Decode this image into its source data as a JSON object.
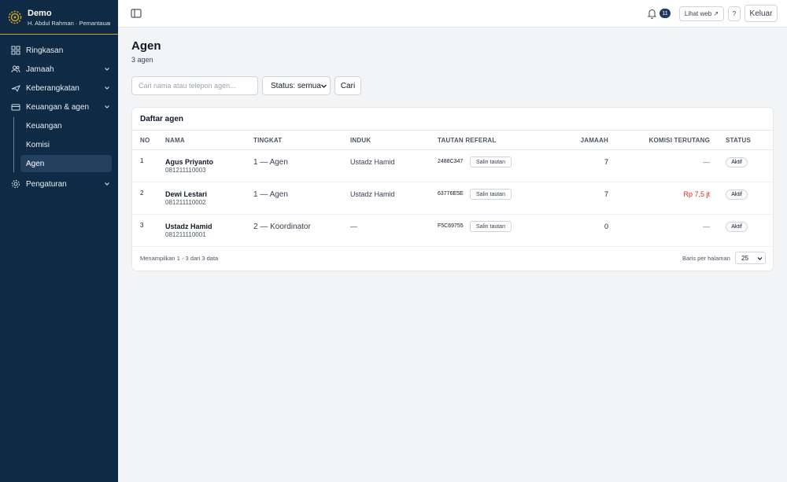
{
  "brand": {
    "title": "Demo",
    "subtitle": "H. Abdul Rahman · Pemantauan"
  },
  "sidebar": {
    "items": [
      {
        "label": "Ringkasan",
        "icon": "grid-icon"
      },
      {
        "label": "Jamaah",
        "icon": "users-icon"
      },
      {
        "label": "Keberangkatan",
        "icon": "plane-icon"
      },
      {
        "label": "Keuangan & agen",
        "icon": "wallet-icon"
      },
      {
        "label": "Pengaturan",
        "icon": "gear-icon"
      }
    ],
    "subitems": [
      {
        "label": "Keuangan"
      },
      {
        "label": "Komisi"
      },
      {
        "label": "Agen",
        "active": true
      }
    ]
  },
  "topbar": {
    "notif_count": "11",
    "lihat_web": "Lihat web ↗",
    "help": "?",
    "logout": "Keluar"
  },
  "page": {
    "title": "Agen",
    "subtitle": "3 agen"
  },
  "filters": {
    "search_placeholder": "Cari nama atau telepon agen...",
    "status": "Status: semua",
    "search_button": "Cari"
  },
  "table": {
    "title": "Daftar agen",
    "headers": {
      "no": "No",
      "name": "Nama",
      "tier": "Tingkat",
      "parent": "Induk",
      "ref": "Tautan referal",
      "jamaah": "Jamaah",
      "commission": "Komisi terutang",
      "status": "Status"
    },
    "copy_label": "Salin tautan",
    "rows": [
      {
        "no": "1",
        "name": "Agus Priyanto",
        "phone": "081211110003",
        "tier": "1 — Agen",
        "parent": "Ustadz Hamid",
        "ref": "2488C347",
        "jamaah": "7",
        "commission": "—",
        "status": "Aktif"
      },
      {
        "no": "2",
        "name": "Dewi Lestari",
        "phone": "081211110002",
        "tier": "1 — Agen",
        "parent": "Ustadz Hamid",
        "ref": "63776E5E",
        "jamaah": "7",
        "commission": "Rp 7,5 jt",
        "status": "Aktif"
      },
      {
        "no": "3",
        "name": "Ustadz Hamid",
        "phone": "081211110001",
        "tier": "2 — Koordinator",
        "parent": "—",
        "ref": "F5C69755",
        "jamaah": "0",
        "commission": "—",
        "status": "Aktif"
      }
    ],
    "footer": "Menampilkan 1 - 3 dari 3 data",
    "per_page_label": "Baris per halaman",
    "per_page": "25"
  },
  "colors": {
    "sidebar_bg": "#0f2a44",
    "accent_gold": "#c9a227",
    "money_red": "#dc2626"
  }
}
